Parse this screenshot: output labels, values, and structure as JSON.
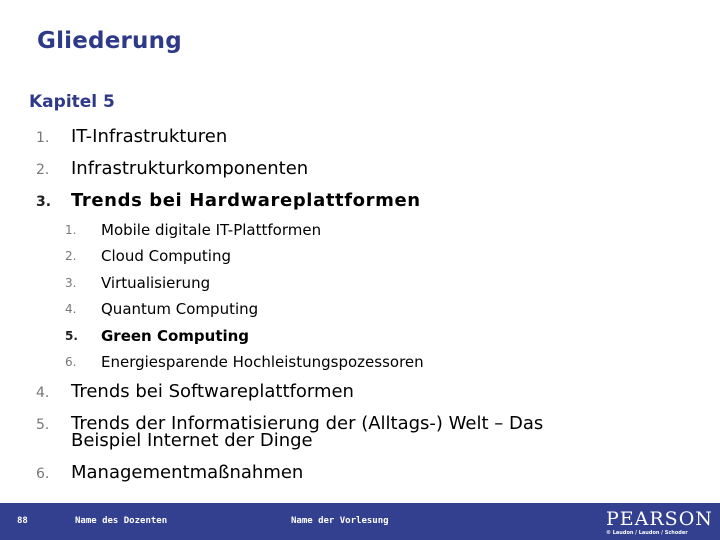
{
  "slide": {
    "title": "Gliederung",
    "chapter": "Kapitel 5",
    "items": [
      {
        "num": "1.",
        "label": "IT-Infrastrukturen",
        "active": false
      },
      {
        "num": "2.",
        "label": "Infrastrukturkomponenten",
        "active": false
      },
      {
        "num": "3.",
        "label": "Trends bei Hardwareplattformen",
        "active": true,
        "subitems": [
          {
            "num": "1.",
            "label": "Mobile digitale IT-Plattformen",
            "active": false
          },
          {
            "num": "2.",
            "label": "Cloud Computing",
            "active": false
          },
          {
            "num": "3.",
            "label": "Virtualisierung",
            "active": false
          },
          {
            "num": "4.",
            "label": "Quantum Computing",
            "active": false
          },
          {
            "num": "5.",
            "label": "Green Computing",
            "active": true
          },
          {
            "num": "6.",
            "label": "Energiesparende Hochleistungspozessoren",
            "active": false
          }
        ]
      },
      {
        "num": "4.",
        "label": "Trends bei Softwareplattformen",
        "active": false
      },
      {
        "num": "5.",
        "label": "Trends der Informatisierung der (Alltags-) Welt – Das",
        "label_line2": "Beispiel Internet der Dinge",
        "active": false
      },
      {
        "num": "6.",
        "label": "Managementmaßnahmen",
        "active": false
      }
    ]
  },
  "footer": {
    "page_number": "88",
    "lecturer": "Name des Dozenten",
    "course": "Name der Vorlesung",
    "logo": "PEARSON",
    "copyright": "© Laudon / Laudon / Schoder"
  },
  "colors": {
    "accent": "#2e3a87",
    "footer_bg": "#33408f"
  }
}
